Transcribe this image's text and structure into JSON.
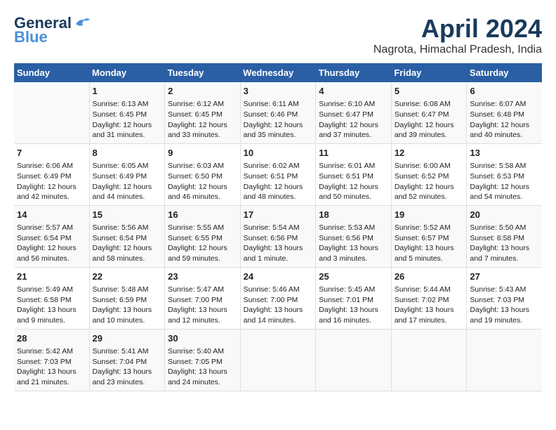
{
  "logo": {
    "line1": "General",
    "line2": "Blue"
  },
  "title": "April 2024",
  "subtitle": "Nagrota, Himachal Pradesh, India",
  "days_header": [
    "Sunday",
    "Monday",
    "Tuesday",
    "Wednesday",
    "Thursday",
    "Friday",
    "Saturday"
  ],
  "weeks": [
    [
      {
        "num": "",
        "text": ""
      },
      {
        "num": "1",
        "text": "Sunrise: 6:13 AM\nSunset: 6:45 PM\nDaylight: 12 hours\nand 31 minutes."
      },
      {
        "num": "2",
        "text": "Sunrise: 6:12 AM\nSunset: 6:45 PM\nDaylight: 12 hours\nand 33 minutes."
      },
      {
        "num": "3",
        "text": "Sunrise: 6:11 AM\nSunset: 6:46 PM\nDaylight: 12 hours\nand 35 minutes."
      },
      {
        "num": "4",
        "text": "Sunrise: 6:10 AM\nSunset: 6:47 PM\nDaylight: 12 hours\nand 37 minutes."
      },
      {
        "num": "5",
        "text": "Sunrise: 6:08 AM\nSunset: 6:47 PM\nDaylight: 12 hours\nand 39 minutes."
      },
      {
        "num": "6",
        "text": "Sunrise: 6:07 AM\nSunset: 6:48 PM\nDaylight: 12 hours\nand 40 minutes."
      }
    ],
    [
      {
        "num": "7",
        "text": "Sunrise: 6:06 AM\nSunset: 6:49 PM\nDaylight: 12 hours\nand 42 minutes."
      },
      {
        "num": "8",
        "text": "Sunrise: 6:05 AM\nSunset: 6:49 PM\nDaylight: 12 hours\nand 44 minutes."
      },
      {
        "num": "9",
        "text": "Sunrise: 6:03 AM\nSunset: 6:50 PM\nDaylight: 12 hours\nand 46 minutes."
      },
      {
        "num": "10",
        "text": "Sunrise: 6:02 AM\nSunset: 6:51 PM\nDaylight: 12 hours\nand 48 minutes."
      },
      {
        "num": "11",
        "text": "Sunrise: 6:01 AM\nSunset: 6:51 PM\nDaylight: 12 hours\nand 50 minutes."
      },
      {
        "num": "12",
        "text": "Sunrise: 6:00 AM\nSunset: 6:52 PM\nDaylight: 12 hours\nand 52 minutes."
      },
      {
        "num": "13",
        "text": "Sunrise: 5:58 AM\nSunset: 6:53 PM\nDaylight: 12 hours\nand 54 minutes."
      }
    ],
    [
      {
        "num": "14",
        "text": "Sunrise: 5:57 AM\nSunset: 6:54 PM\nDaylight: 12 hours\nand 56 minutes."
      },
      {
        "num": "15",
        "text": "Sunrise: 5:56 AM\nSunset: 6:54 PM\nDaylight: 12 hours\nand 58 minutes."
      },
      {
        "num": "16",
        "text": "Sunrise: 5:55 AM\nSunset: 6:55 PM\nDaylight: 12 hours\nand 59 minutes."
      },
      {
        "num": "17",
        "text": "Sunrise: 5:54 AM\nSunset: 6:56 PM\nDaylight: 13 hours\nand 1 minute."
      },
      {
        "num": "18",
        "text": "Sunrise: 5:53 AM\nSunset: 6:56 PM\nDaylight: 13 hours\nand 3 minutes."
      },
      {
        "num": "19",
        "text": "Sunrise: 5:52 AM\nSunset: 6:57 PM\nDaylight: 13 hours\nand 5 minutes."
      },
      {
        "num": "20",
        "text": "Sunrise: 5:50 AM\nSunset: 6:58 PM\nDaylight: 13 hours\nand 7 minutes."
      }
    ],
    [
      {
        "num": "21",
        "text": "Sunrise: 5:49 AM\nSunset: 6:58 PM\nDaylight: 13 hours\nand 9 minutes."
      },
      {
        "num": "22",
        "text": "Sunrise: 5:48 AM\nSunset: 6:59 PM\nDaylight: 13 hours\nand 10 minutes."
      },
      {
        "num": "23",
        "text": "Sunrise: 5:47 AM\nSunset: 7:00 PM\nDaylight: 13 hours\nand 12 minutes."
      },
      {
        "num": "24",
        "text": "Sunrise: 5:46 AM\nSunset: 7:00 PM\nDaylight: 13 hours\nand 14 minutes."
      },
      {
        "num": "25",
        "text": "Sunrise: 5:45 AM\nSunset: 7:01 PM\nDaylight: 13 hours\nand 16 minutes."
      },
      {
        "num": "26",
        "text": "Sunrise: 5:44 AM\nSunset: 7:02 PM\nDaylight: 13 hours\nand 17 minutes."
      },
      {
        "num": "27",
        "text": "Sunrise: 5:43 AM\nSunset: 7:03 PM\nDaylight: 13 hours\nand 19 minutes."
      }
    ],
    [
      {
        "num": "28",
        "text": "Sunrise: 5:42 AM\nSunset: 7:03 PM\nDaylight: 13 hours\nand 21 minutes."
      },
      {
        "num": "29",
        "text": "Sunrise: 5:41 AM\nSunset: 7:04 PM\nDaylight: 13 hours\nand 23 minutes."
      },
      {
        "num": "30",
        "text": "Sunrise: 5:40 AM\nSunset: 7:05 PM\nDaylight: 13 hours\nand 24 minutes."
      },
      {
        "num": "",
        "text": ""
      },
      {
        "num": "",
        "text": ""
      },
      {
        "num": "",
        "text": ""
      },
      {
        "num": "",
        "text": ""
      }
    ]
  ]
}
